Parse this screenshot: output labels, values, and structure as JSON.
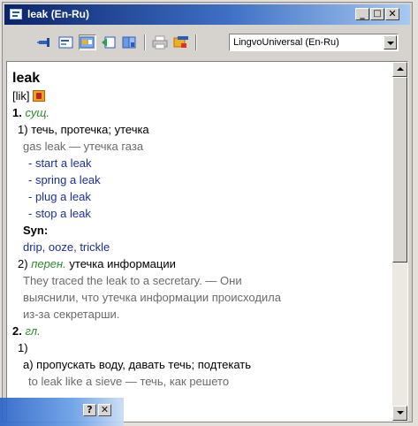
{
  "window": {
    "title": "leak (En-Ru)",
    "minimize_label": "_",
    "maximize_label": "□",
    "close_label": "✕"
  },
  "toolbar": {
    "icons": [
      "pin-icon",
      "card-icon",
      "view-icon",
      "back-icon",
      "dictionaries-icon",
      "print-icon",
      "highlighter-icon"
    ],
    "dictionary_selected": "LingvoUniversal (En-Ru)"
  },
  "entry": {
    "headword": "leak",
    "transcription": "[lik]",
    "sense1": {
      "number": "1.",
      "pos": "сущ.",
      "sub1": {
        "number": "1)",
        "translation": "течь, протечка; утечка",
        "example": "gas leak — утечка газа",
        "phrases": [
          "- start a leak",
          "- spring a leak",
          "- plug a leak",
          "- stop a leak"
        ],
        "syn_label": "Syn:",
        "syn_values": "drip, ooze, trickle"
      },
      "sub2": {
        "number": "2)",
        "domain": "перен.",
        "translation": "утечка информации",
        "example_lines": [
          "They traced the leak to a secretary. — Они",
          "выяснили, что утечка информации происходила",
          "из-за секретарши."
        ]
      }
    },
    "sense2": {
      "number": "2.",
      "pos": "гл.",
      "sub1_number": "1)",
      "sub_a": "а) пропускать воду, давать течь; подтекать",
      "sub_a_example": "to leak like a sieve — течь, как решето"
    }
  },
  "colors": {
    "titlebar_start": "#0a246a",
    "titlebar_end": "#a6caf0",
    "translation_blue": "#1c2e9a",
    "pos_green": "#2d8a2d",
    "example_grey": "#6a6a6a"
  },
  "help_bar": {
    "help_label": "?",
    "close_label": "✕"
  }
}
